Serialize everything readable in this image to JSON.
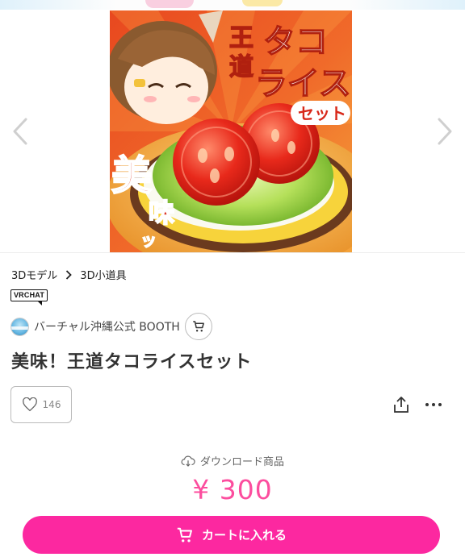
{
  "gallery": {
    "prev_icon": "chevron-left-icon",
    "next_icon": "chevron-right-icon",
    "artwork": {
      "title_line1": "王",
      "title_line2": "道",
      "title_big1": "タコ",
      "title_big2": "ライス",
      "set_label": "セット",
      "flavor_big": "美",
      "flavor_small": "味",
      "flavor_tail": "ッ"
    }
  },
  "breadcrumb": {
    "items": [
      "3Dモデル",
      "3D小道具"
    ],
    "separator_icon": "chevron-right-icon"
  },
  "badge": {
    "label": "VRCHAT"
  },
  "shop": {
    "name": "バーチャル沖縄公式 BOOTH",
    "cart_icon": "cart-icon"
  },
  "product": {
    "title": "美味！王道タコライスセット",
    "likes": "146",
    "like_icon": "heart-icon",
    "share_icon": "share-icon",
    "more_icon": "more-dots-icon"
  },
  "purchase": {
    "download_label": "ダウンロード商品",
    "download_icon": "cloud-download-icon",
    "price": "¥ 300",
    "cart_button_label": "カートに入れる",
    "cart_button_icon": "cart-icon",
    "accent_color": "#fc28a0",
    "price_color": "#fc4d9e"
  }
}
